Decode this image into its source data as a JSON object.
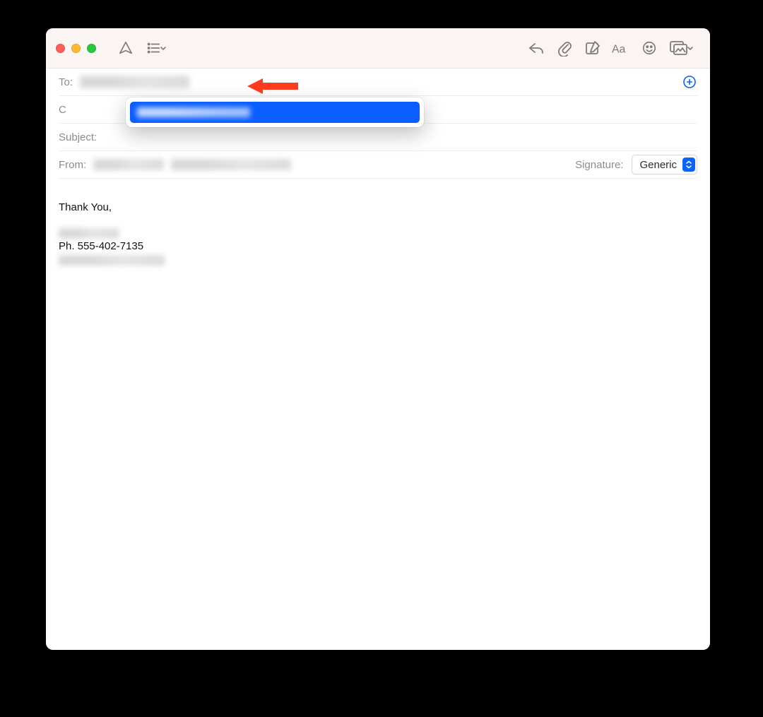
{
  "toolbar": {
    "icons": {
      "send": "send-icon",
      "list": "list-icon",
      "reply": "reply-icon",
      "attach": "attach-icon",
      "compose": "compose-icon",
      "font": "font-icon",
      "emoji": "emoji-icon",
      "media": "media-icon"
    }
  },
  "fields": {
    "to_label": "To:",
    "cc_label": "C",
    "subject_label": "Subject:",
    "from_label": "From:",
    "signature_label": "Signature:"
  },
  "signature_select": {
    "value": "Generic"
  },
  "body": {
    "thank_you": "Thank You,",
    "phone": "Ph. 555-402-7135"
  },
  "colors": {
    "accent": "#0a63ff",
    "toolbar_bg": "#faf4f3",
    "label": "#8c8c8c",
    "annotation": "#ff3b1f"
  }
}
